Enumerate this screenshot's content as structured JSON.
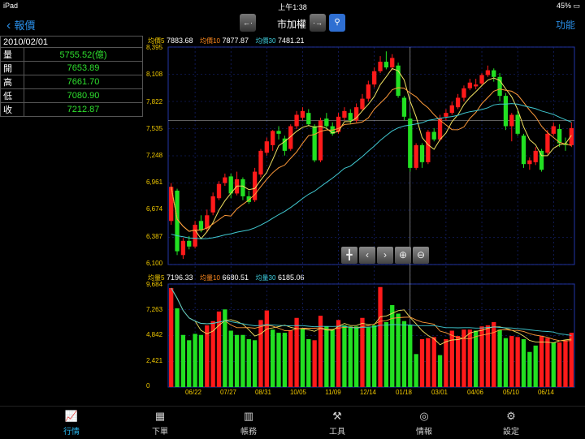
{
  "status": {
    "device": "iPad",
    "time": "上午1:38",
    "battery": "45%"
  },
  "nav": {
    "back_label": "報價",
    "title": "市加權",
    "function_label": "功能",
    "prev_label": "←·",
    "next_label": "·→"
  },
  "info": {
    "date": "2010/02/01",
    "rows": [
      {
        "label": "量",
        "value": "5755.52(億)"
      },
      {
        "label": "開",
        "value": "7653.89"
      },
      {
        "label": "高",
        "value": "7661.70"
      },
      {
        "label": "低",
        "value": "7080.90"
      },
      {
        "label": "收",
        "value": "7212.87"
      }
    ]
  },
  "price_legend": {
    "ma5_label": "均價5",
    "ma5": "7883.68",
    "ma10_label": "均價10",
    "ma10": "7877.87",
    "ma30_label": "均價30",
    "ma30": "7481.21"
  },
  "volume_legend": {
    "ma5_label": "均量5",
    "ma5": "7196.33",
    "ma10_label": "均量10",
    "ma10": "6680.51",
    "ma30_label": "均量30",
    "ma30": "6185.06"
  },
  "price_ticks": [
    "8,395",
    "8,108",
    "7,822",
    "7,535",
    "7,248",
    "6,961",
    "6,674",
    "6,387",
    "6,100"
  ],
  "volume_ticks": [
    "9,684",
    "7,263",
    "4,842",
    "2,421",
    "0"
  ],
  "x_ticks": [
    "06/22",
    "07/27",
    "08/31",
    "10/05",
    "11/09",
    "12/14",
    "01/18",
    "03/01",
    "04/06",
    "05/10",
    "06/14"
  ],
  "tabs": [
    {
      "label": "行情",
      "icon": "chart-icon"
    },
    {
      "label": "下單",
      "icon": "order-icon"
    },
    {
      "label": "帳務",
      "icon": "account-icon"
    },
    {
      "label": "工具",
      "icon": "tools-icon"
    },
    {
      "label": "情報",
      "icon": "news-icon"
    },
    {
      "label": "設定",
      "icon": "gear-icon"
    }
  ],
  "chart_data": [
    {
      "type": "candlestick",
      "ylim": [
        6100,
        8395
      ],
      "categories": [
        "06/22",
        "07/27",
        "08/31",
        "10/05",
        "11/09",
        "12/14",
        "01/18",
        "03/01",
        "04/06",
        "05/10",
        "06/14"
      ],
      "colors": {
        "up": "#ff1a1a",
        "down": "#22e022",
        "ma5": "#f0e060",
        "ma10": "#ff9a3a",
        "ma30": "#40c8d0"
      },
      "candles": [
        [
          6560,
          6920,
          6960,
          6520
        ],
        [
          6880,
          6240,
          6900,
          6200
        ],
        [
          6200,
          6350,
          6380,
          6160
        ],
        [
          6350,
          6290,
          6400,
          6260
        ],
        [
          6290,
          6520,
          6560,
          6270
        ],
        [
          6560,
          6460,
          6620,
          6440
        ],
        [
          6480,
          6620,
          6680,
          6440
        ],
        [
          6650,
          6820,
          6860,
          6620
        ],
        [
          6800,
          6950,
          6980,
          6780
        ],
        [
          6960,
          7020,
          7060,
          6930
        ],
        [
          7030,
          6850,
          7060,
          6800
        ],
        [
          6850,
          7000,
          7080,
          6830
        ],
        [
          7000,
          6820,
          7020,
          6780
        ],
        [
          6820,
          6760,
          6880,
          6740
        ],
        [
          6780,
          7080,
          7120,
          6760
        ],
        [
          7050,
          7300,
          7320,
          7020
        ],
        [
          7280,
          7400,
          7440,
          7250
        ],
        [
          7360,
          7510,
          7520,
          7300
        ],
        [
          7510,
          7480,
          7560,
          7420
        ],
        [
          7430,
          7300,
          7460,
          7250
        ],
        [
          7320,
          7560,
          7580,
          7300
        ],
        [
          7560,
          7680,
          7720,
          7530
        ],
        [
          7650,
          7720,
          7760,
          7620
        ],
        [
          7700,
          7580,
          7740,
          7560
        ],
        [
          7560,
          7200,
          7580,
          7180
        ],
        [
          7200,
          7620,
          7650,
          7180
        ],
        [
          7640,
          7560,
          7700,
          7540
        ],
        [
          7560,
          7480,
          7600,
          7460
        ],
        [
          7500,
          7660,
          7700,
          7480
        ],
        [
          7650,
          7720,
          7760,
          7620
        ],
        [
          7700,
          7620,
          7740,
          7580
        ],
        [
          7620,
          7760,
          7800,
          7600
        ],
        [
          7740,
          7850,
          7900,
          7720
        ],
        [
          7850,
          8000,
          8040,
          7820
        ],
        [
          8000,
          8140,
          8180,
          7970
        ],
        [
          8140,
          8240,
          8300,
          8120
        ],
        [
          8240,
          8180,
          8350,
          8160
        ],
        [
          8180,
          8280,
          8320,
          8150
        ],
        [
          8200,
          7880,
          8230,
          7860
        ],
        [
          7860,
          7660,
          7880,
          7620
        ],
        [
          7640,
          7120,
          7700,
          7080
        ],
        [
          7120,
          7360,
          7380,
          7100
        ],
        [
          7360,
          7180,
          7380,
          7120
        ],
        [
          7180,
          7500,
          7520,
          7160
        ],
        [
          7500,
          7420,
          7540,
          7400
        ],
        [
          7420,
          7640,
          7680,
          7400
        ],
        [
          7660,
          7700,
          7740,
          7620
        ],
        [
          7700,
          7780,
          7820,
          7680
        ],
        [
          7760,
          7860,
          7900,
          7740
        ],
        [
          7860,
          7960,
          7990,
          7820
        ],
        [
          7960,
          8020,
          8060,
          7940
        ],
        [
          7980,
          8000,
          8060,
          7950
        ],
        [
          8010,
          8100,
          8120,
          7990
        ],
        [
          8100,
          8150,
          8200,
          8080
        ],
        [
          8150,
          8080,
          8170,
          8030
        ],
        [
          8080,
          7880,
          8120,
          7820
        ],
        [
          7880,
          7560,
          7910,
          7520
        ],
        [
          7560,
          7680,
          7700,
          7400
        ],
        [
          7680,
          7480,
          7720,
          7460
        ],
        [
          7460,
          7160,
          7480,
          7120
        ],
        [
          7160,
          7200,
          7230,
          7100
        ],
        [
          7180,
          7300,
          7340,
          7150
        ],
        [
          7300,
          7100,
          7320,
          7080
        ],
        [
          7280,
          7480,
          7520,
          7260
        ],
        [
          7480,
          7560,
          7600,
          7460
        ],
        [
          7530,
          7380,
          7580,
          7340
        ],
        [
          7380,
          7360,
          7440,
          7300
        ],
        [
          7360,
          7540,
          7600,
          7340
        ]
      ]
    },
    {
      "type": "bar",
      "ylim": [
        0,
        9684
      ],
      "colors": {
        "up": "#ff1a1a",
        "down": "#22e022"
      },
      "values": [
        [
          9300,
          1
        ],
        [
          7400,
          0
        ],
        [
          4900,
          0
        ],
        [
          4400,
          0
        ],
        [
          5000,
          0
        ],
        [
          4900,
          0
        ],
        [
          5800,
          1
        ],
        [
          6200,
          1
        ],
        [
          7100,
          1
        ],
        [
          7300,
          0
        ],
        [
          5300,
          0
        ],
        [
          4900,
          0
        ],
        [
          4900,
          0
        ],
        [
          4500,
          0
        ],
        [
          4400,
          0
        ],
        [
          6300,
          1
        ],
        [
          7200,
          1
        ],
        [
          5400,
          0
        ],
        [
          5100,
          0
        ],
        [
          5100,
          0
        ],
        [
          5300,
          1
        ],
        [
          6500,
          1
        ],
        [
          5500,
          0
        ],
        [
          4500,
          0
        ],
        [
          4400,
          1
        ],
        [
          6700,
          1
        ],
        [
          5700,
          0
        ],
        [
          5400,
          0
        ],
        [
          6300,
          1
        ],
        [
          5800,
          0
        ],
        [
          5700,
          0
        ],
        [
          5700,
          0
        ],
        [
          6500,
          1
        ],
        [
          5600,
          0
        ],
        [
          5800,
          0
        ],
        [
          9400,
          1
        ],
        [
          6100,
          0
        ],
        [
          7700,
          0
        ],
        [
          6900,
          0
        ],
        [
          6200,
          0
        ],
        [
          5800,
          0
        ],
        [
          3100,
          0
        ],
        [
          4500,
          1
        ],
        [
          4600,
          1
        ],
        [
          4700,
          1
        ],
        [
          3000,
          0
        ],
        [
          4500,
          1
        ],
        [
          5300,
          1
        ],
        [
          4800,
          1
        ],
        [
          5400,
          1
        ],
        [
          5400,
          1
        ],
        [
          5300,
          0
        ],
        [
          5700,
          1
        ],
        [
          5800,
          1
        ],
        [
          6100,
          1
        ],
        [
          5400,
          0
        ],
        [
          4600,
          0
        ],
        [
          4800,
          1
        ],
        [
          4700,
          1
        ],
        [
          4500,
          0
        ],
        [
          3300,
          0
        ],
        [
          3900,
          0
        ],
        [
          4800,
          1
        ],
        [
          4600,
          1
        ],
        [
          4200,
          0
        ],
        [
          4200,
          1
        ],
        [
          4400,
          1
        ],
        [
          5100,
          1
        ]
      ]
    }
  ]
}
